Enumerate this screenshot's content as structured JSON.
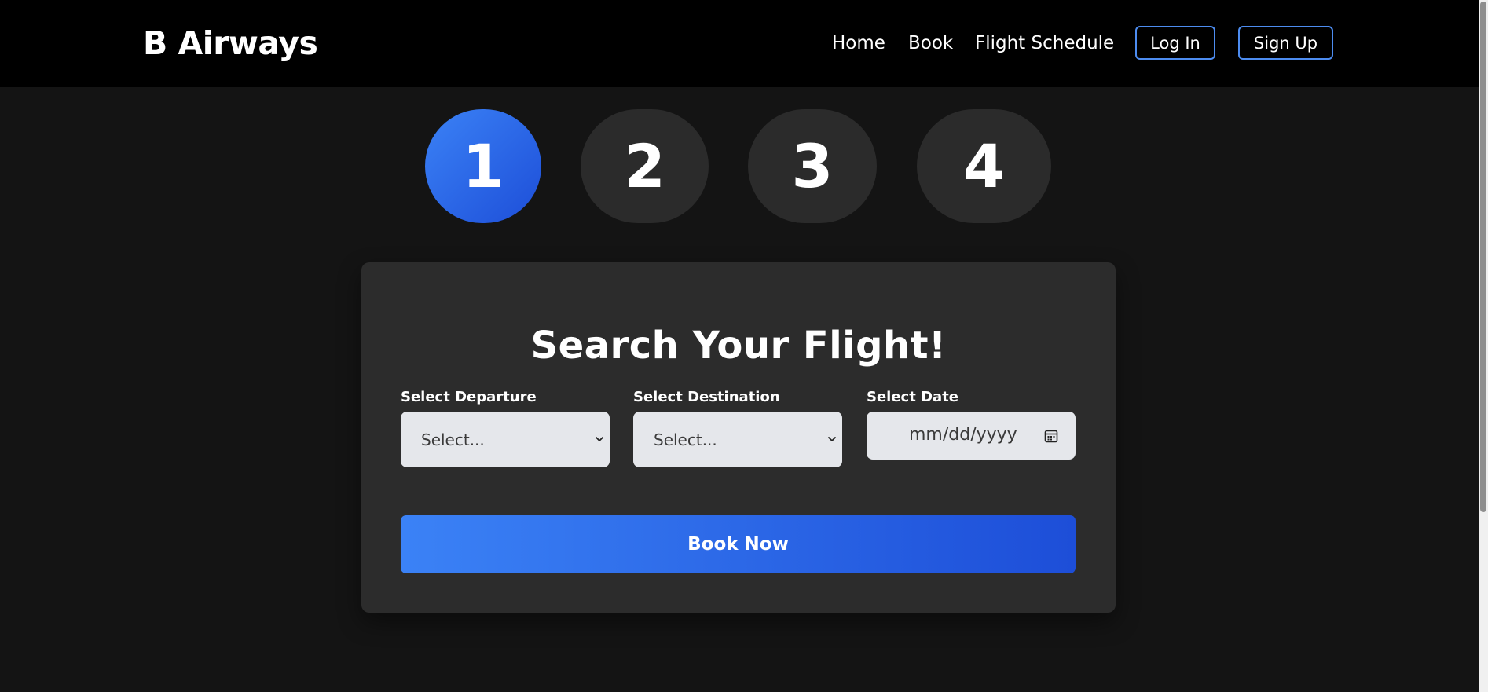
{
  "header": {
    "brand": "B Airways",
    "nav": {
      "home": "Home",
      "book": "Book",
      "schedule": "Flight Schedule"
    },
    "login": "Log In",
    "signup": "Sign Up"
  },
  "steps": [
    {
      "label": "1",
      "active": true
    },
    {
      "label": "2",
      "active": false
    },
    {
      "label": "3",
      "active": false
    },
    {
      "label": "4",
      "active": false
    }
  ],
  "search": {
    "title": "Search Your Flight!",
    "departure": {
      "label": "Select Departure",
      "value": "Select..."
    },
    "destination": {
      "label": "Select Destination",
      "value": "Select..."
    },
    "date": {
      "label": "Select Date",
      "placeholder": "mm/dd/yyyy"
    },
    "submit": "Book Now"
  },
  "colors": {
    "accent": "#3b82f6",
    "accent_dark": "#1d4ed8",
    "button_outline": "#4d8cf0",
    "header_bg": "#000000",
    "page_bg": "#141414",
    "card_bg": "#2c2c2c",
    "inactive_step": "#2b2b2b"
  }
}
